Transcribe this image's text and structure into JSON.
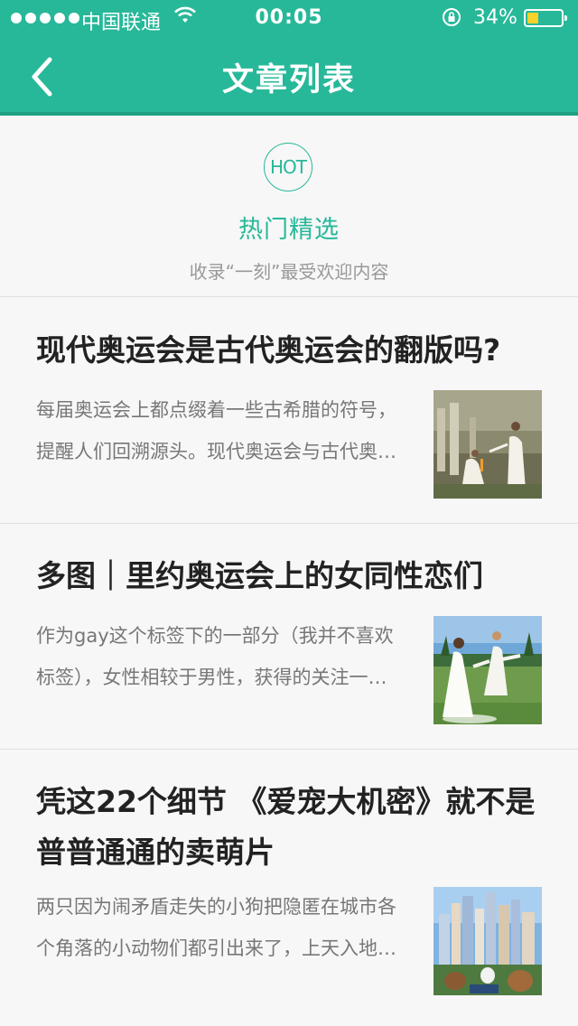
{
  "status_bar": {
    "carrier": "中国联通",
    "time": "00:05",
    "battery": "34%",
    "battery_level": 0.34,
    "battery_color": "#f8d12a"
  },
  "nav": {
    "title": "文章列表",
    "back_icon": "chevron-left-icon"
  },
  "hot": {
    "badge": "HOT",
    "title": "热门精选",
    "subtitle": "收录“一刻”最受欢迎内容"
  },
  "articles": [
    {
      "title": "现代奥运会是古代奥运会的翻版吗?",
      "summary_line1": "每届奥运会上都点缀着一些古希腊的符号，",
      "summary_line2": "提醒人们回溯源头。现代奥运会与古代奥…"
    },
    {
      "title": "多图｜里约奥运会上的女同性恋们",
      "summary_line1": "作为gay这个标签下的一部分（我并不喜欢",
      "summary_line2": "标签），女性相较于男性，获得的关注一…"
    },
    {
      "title_line1": "凭这22个细节 《爱宠大机密》就不是",
      "title_line2": "普普通通的卖萌片",
      "summary_line1": "两只因为闹矛盾走失的小狗把隐匿在城市各",
      "summary_line2": "个角落的小动物们都引出来了，上天入地…"
    }
  ],
  "theme": {
    "accent": "#27b899"
  }
}
